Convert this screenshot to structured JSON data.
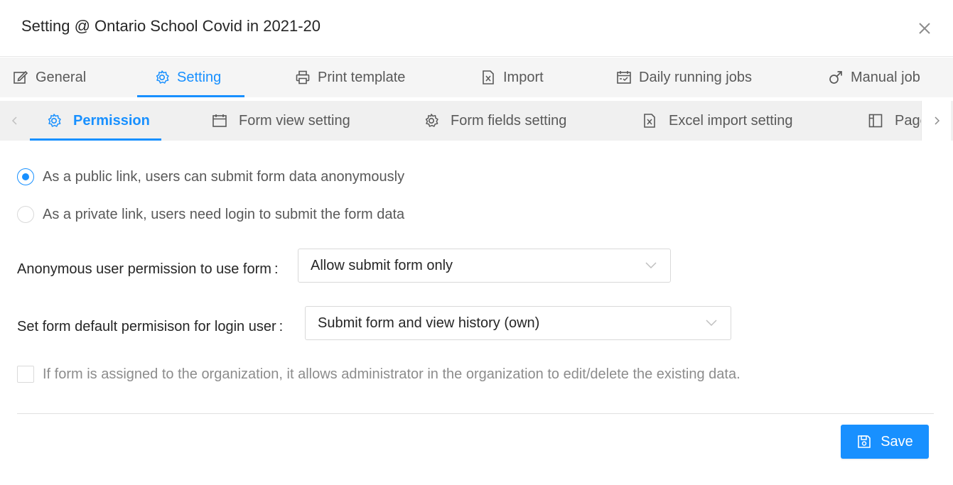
{
  "dialog": {
    "title": "Setting @ Ontario School Covid in 2021-20",
    "close_icon": "close-icon"
  },
  "main_tabs": [
    {
      "label": "General",
      "icon": "edit-icon",
      "active": false
    },
    {
      "label": "Setting",
      "icon": "gear-icon",
      "active": true
    },
    {
      "label": "Print template",
      "icon": "printer-icon",
      "active": false
    },
    {
      "label": "Import",
      "icon": "excel-file-icon",
      "active": false
    },
    {
      "label": "Daily running jobs",
      "icon": "calendar-check-icon",
      "active": false
    },
    {
      "label": "Manual job",
      "icon": "male-icon",
      "active": false
    }
  ],
  "sub_tabs": [
    {
      "label": "Permission",
      "icon": "gear-icon",
      "active": true
    },
    {
      "label": "Form view setting",
      "icon": "calendar-icon",
      "active": false
    },
    {
      "label": "Form fields setting",
      "icon": "gear-icon",
      "active": false
    },
    {
      "label": "Excel import setting",
      "icon": "excel-file-icon",
      "active": false
    },
    {
      "label": "Page",
      "icon": "layout-icon",
      "active": false
    }
  ],
  "permission": {
    "link_options": [
      {
        "label": "As a public link, users can submit form data anonymously",
        "checked": true
      },
      {
        "label": "As a private link, users need login to submit the form data",
        "checked": false
      }
    ],
    "anonymous_label": "Anonymous user permission to use form",
    "anonymous_value": "Allow submit form only",
    "login_label": "Set form default permisison for login user",
    "login_value": "Submit form and view history (own)",
    "org_admin_checkbox_label": "If form is assigned to the organization, it allows administrator in the organization to edit/delete the existing data.",
    "org_admin_checked": false,
    "label_separator": ":"
  },
  "footer": {
    "save_label": "Save"
  },
  "colors": {
    "accent": "#1890ff"
  }
}
